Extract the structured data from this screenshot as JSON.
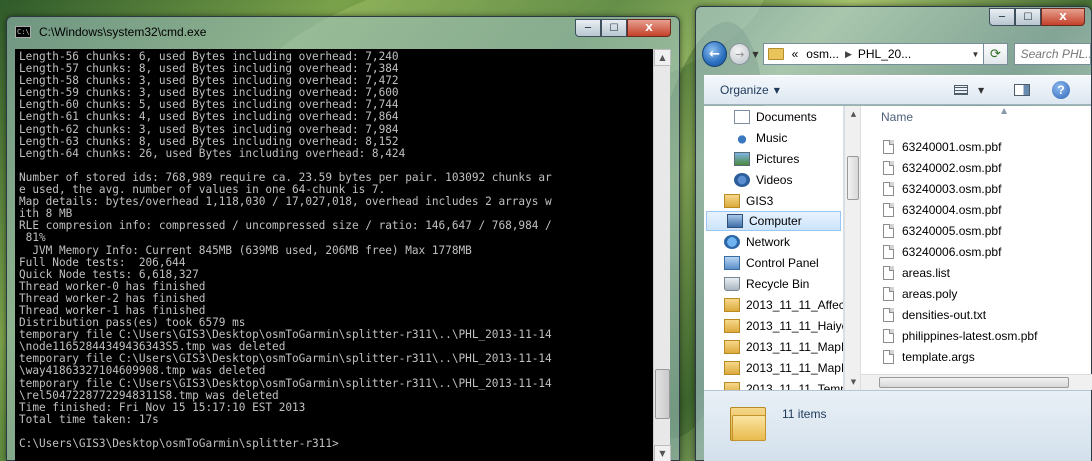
{
  "cmd": {
    "title": "C:\\Windows\\system32\\cmd.exe",
    "icon_text": "C:\\",
    "buttons": {
      "minimize": "─",
      "maximize": "☐",
      "close": "X"
    },
    "lines": [
      "Length-56 chunks: 6, used Bytes including overhead: 7,240",
      "Length-57 chunks: 8, used Bytes including overhead: 7,384",
      "Length-58 chunks: 3, used Bytes including overhead: 7,472",
      "Length-59 chunks: 3, used Bytes including overhead: 7,600",
      "Length-60 chunks: 5, used Bytes including overhead: 7,744",
      "Length-61 chunks: 4, used Bytes including overhead: 7,864",
      "Length-62 chunks: 3, used Bytes including overhead: 7,984",
      "Length-63 chunks: 8, used Bytes including overhead: 8,152",
      "Length-64 chunks: 26, used Bytes including overhead: 8,424",
      "",
      "Number of stored ids: 768,989 require ca. 23.59 bytes per pair. 103092 chunks ar",
      "e used, the avg. number of values in one 64-chunk is 7.",
      "Map details: bytes/overhead 1,118,030 / 17,027,018, overhead includes 2 arrays w",
      "ith 8 MB",
      "RLE compresion info: compressed / uncompressed size / ratio: 146,647 / 768,984 /",
      " 81%",
      "  JVM Memory Info: Current 845MB (639MB used, 206MB free) Max 1778MB",
      "Full Node tests:  206,644",
      "Quick Node tests: 6,618,327",
      "Thread worker-0 has finished",
      "Thread worker-2 has finished",
      "Thread worker-1 has finished",
      "Distribution pass(es) took 6579 ms",
      "temporary file C:\\Users\\GIS3\\Desktop\\osmToGarmin\\splitter-r311\\..\\PHL_2013-11-14",
      "\\node11652844349436343S5.tmp was deleted",
      "temporary file C:\\Users\\GIS3\\Desktop\\osmToGarmin\\splitter-r311\\..\\PHL_2013-11-14",
      "\\way41863327104609908.tmp was deleted",
      "temporary file C:\\Users\\GIS3\\Desktop\\osmToGarmin\\splitter-r311\\..\\PHL_2013-11-14",
      "\\rel50472287722948311S8.tmp was deleted",
      "Time finished: Fri Nov 15 15:17:10 EST 2013",
      "Total time taken: 17s",
      "",
      "C:\\Users\\GIS3\\Desktop\\osmToGarmin\\splitter-r311>"
    ]
  },
  "explorer": {
    "buttons": {
      "minimize": "─",
      "maximize": "☐",
      "close": "X"
    },
    "address": {
      "prefix": "«",
      "segments": [
        "osm...",
        "PHL_20..."
      ]
    },
    "search_placeholder": "Search PHL...",
    "toolbar": {
      "organize": "Organize"
    },
    "nav_items": [
      {
        "label": "Documents",
        "icon": "documents-icon",
        "indent": 1
      },
      {
        "label": "Music",
        "icon": "music-icon",
        "indent": 1
      },
      {
        "label": "Pictures",
        "icon": "pictures-icon",
        "indent": 1
      },
      {
        "label": "Videos",
        "icon": "videos-icon",
        "indent": 1
      },
      {
        "label": "GIS3",
        "icon": "user-folder-icon",
        "indent": 0
      },
      {
        "label": "Computer",
        "icon": "computer-icon",
        "indent": 0,
        "selected": true
      },
      {
        "label": "Network",
        "icon": "network-icon",
        "indent": 0
      },
      {
        "label": "Control Panel",
        "icon": "control-panel-icon",
        "indent": 0
      },
      {
        "label": "Recycle Bin",
        "icon": "recycle-bin-icon",
        "indent": 0
      },
      {
        "label": "2013_11_11_Affec",
        "icon": "folder-icon",
        "indent": 0
      },
      {
        "label": "2013_11_11_Haiyc",
        "icon": "folder-icon",
        "indent": 0
      },
      {
        "label": "2013_11_11_MapF",
        "icon": "folder-icon",
        "indent": 0
      },
      {
        "label": "2013_11_11_MapF",
        "icon": "folder-icon",
        "indent": 0
      },
      {
        "label": "2013_11_11_Temp",
        "icon": "folder-icon",
        "indent": 0
      }
    ],
    "column_header": "Name",
    "files": [
      "63240001.osm.pbf",
      "63240002.osm.pbf",
      "63240003.osm.pbf",
      "63240004.osm.pbf",
      "63240005.osm.pbf",
      "63240006.osm.pbf",
      "areas.list",
      "areas.poly",
      "densities-out.txt",
      "philippines-latest.osm.pbf",
      "template.args"
    ],
    "item_count": "11 items"
  }
}
